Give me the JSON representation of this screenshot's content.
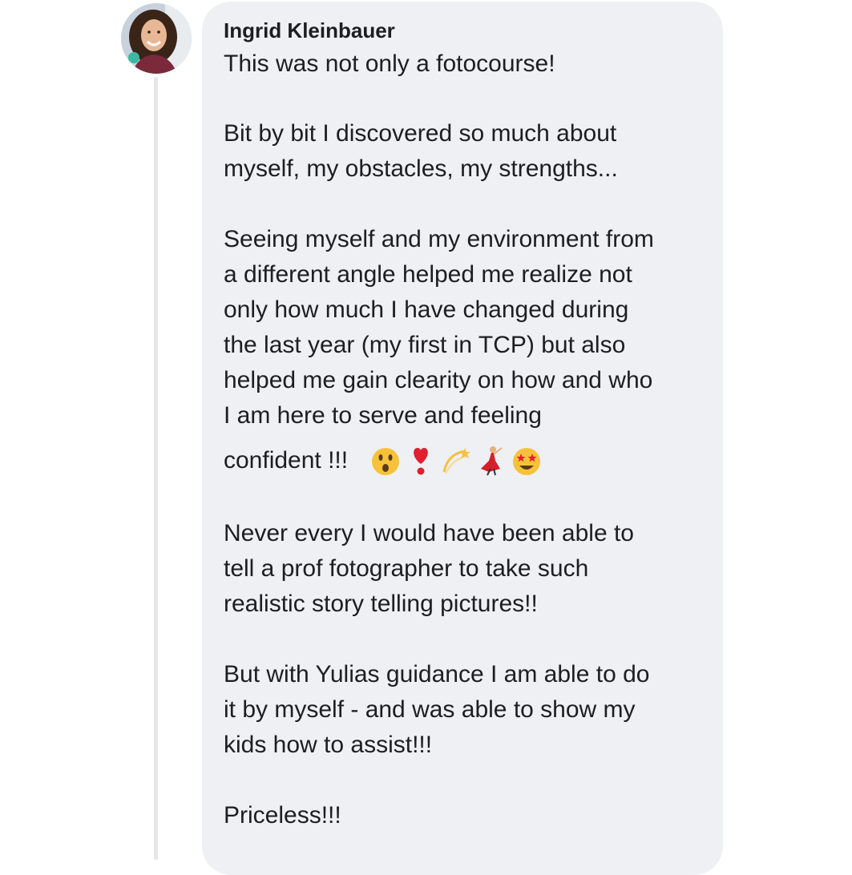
{
  "comment": {
    "author": "Ingrid Kleinbauer",
    "lines": [
      "This was not only a fotocourse!",
      "Bit by bit I discovered so much about",
      "myself, my obstacles, my strengths...",
      "Seeing myself and my environment from",
      "a different angle helped me realize not",
      "only how much I have changed during",
      "the last year (my first in TCP) but also",
      "helped me gain clearity on how and who",
      "I am here to serve and feeling",
      "confident !!!",
      "Never every I would have been able to",
      "tell a prof fotographer to take such",
      "realistic story telling pictures!!",
      "But with Yulias guidance I am able to do",
      "it by myself - and was able to show my",
      "kids how to assist!!!",
      "Priceless!!!"
    ],
    "emojis": [
      "hushed-face-emoji",
      "heart-exclamation-emoji",
      "dizzy-emoji",
      "dancer-emoji",
      "star-struck-emoji"
    ]
  },
  "colors": {
    "bubble": "#eef0f3",
    "text": "#1c1e21",
    "thread_line": "#e4e6ea"
  }
}
